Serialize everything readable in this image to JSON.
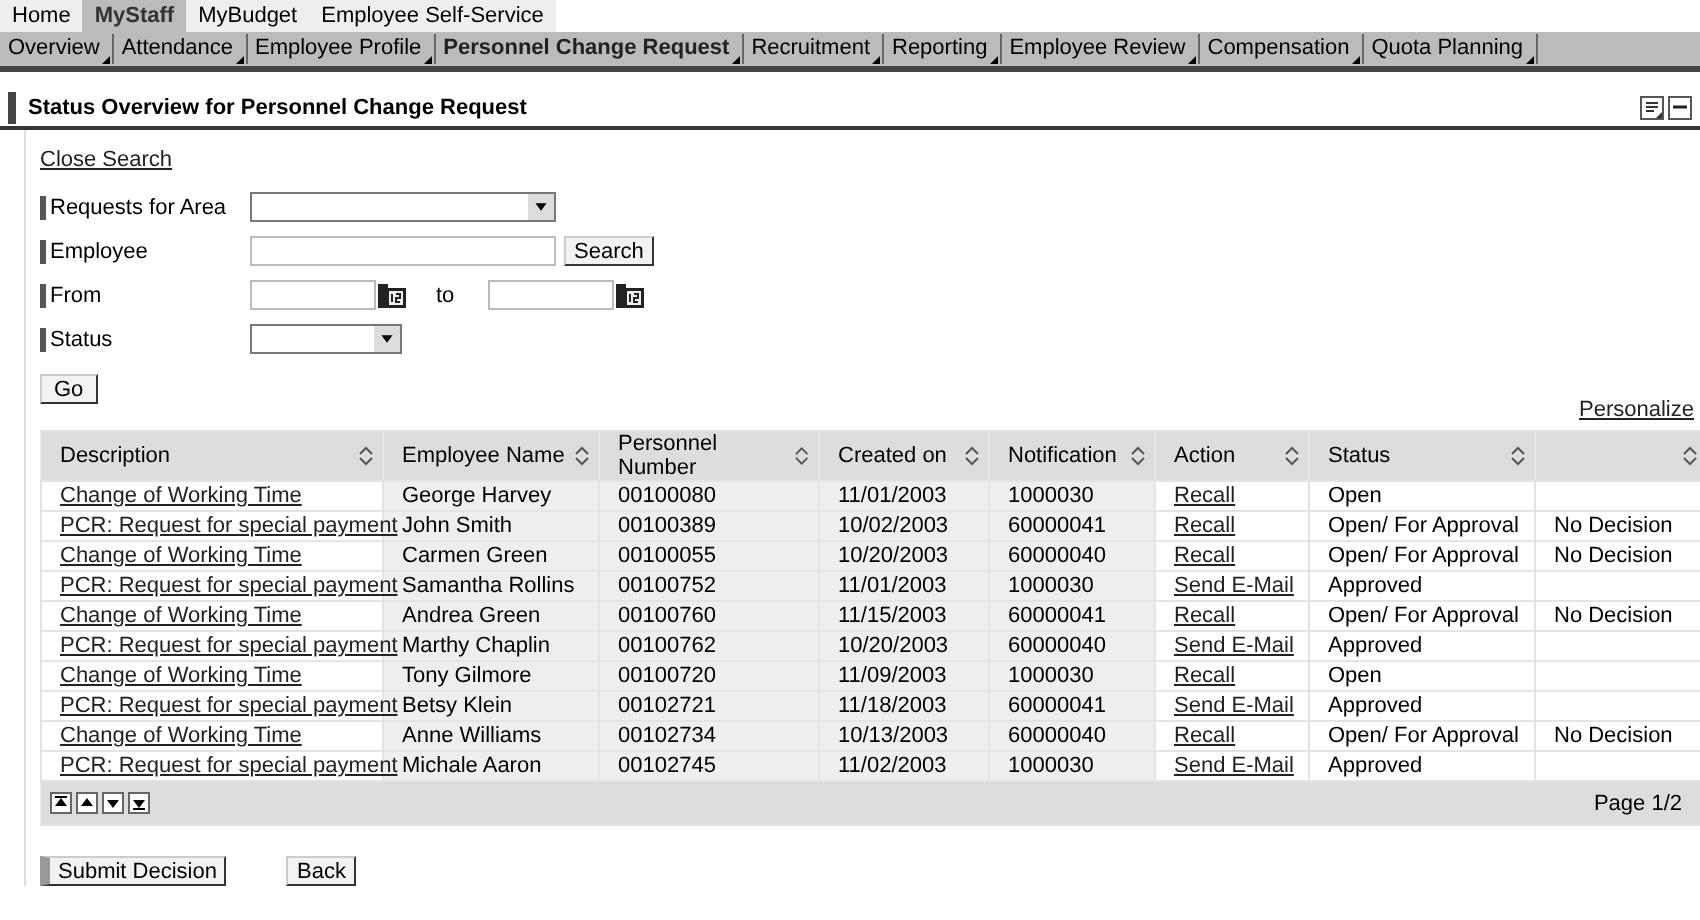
{
  "top_tabs": [
    {
      "label": "Home",
      "selected": false
    },
    {
      "label": "MyStaff",
      "selected": true
    },
    {
      "label": "MyBudget",
      "selected": false
    },
    {
      "label": "Employee Self-Service",
      "selected": false
    }
  ],
  "nav_items": [
    {
      "label": "Overview",
      "selected": false
    },
    {
      "label": "Attendance",
      "selected": false
    },
    {
      "label": "Employee Profile",
      "selected": false
    },
    {
      "label": "Personnel Change Request",
      "selected": true
    },
    {
      "label": "Recruitment",
      "selected": false
    },
    {
      "label": "Reporting",
      "selected": false
    },
    {
      "label": "Employee Review",
      "selected": false
    },
    {
      "label": "Compensation",
      "selected": false
    },
    {
      "label": "Quota Planning",
      "selected": false
    }
  ],
  "panel": {
    "title": "Status Overview for Personnel Change Request"
  },
  "search": {
    "close_link": "Close Search",
    "fields": [
      {
        "kind": "combo",
        "label": "Requests for Area"
      },
      {
        "kind": "text",
        "label": "Employee",
        "button": "Search"
      },
      {
        "kind": "daterange",
        "label": "From",
        "between": "to"
      },
      {
        "kind": "dropdown",
        "label": "Status"
      }
    ],
    "go_button": "Go"
  },
  "personalize_link": "Personalize",
  "table": {
    "columns": [
      "Description",
      "Employee Name",
      "Personnel Number",
      "Created on",
      "Notification",
      "Action",
      "Status",
      ""
    ],
    "rows": [
      [
        "Change of Working Time",
        "George Harvey",
        "00100080",
        "11/01/2003",
        "1000030",
        "Recall",
        "Open",
        ""
      ],
      [
        "PCR: Request for special payment",
        "John Smith",
        "00100389",
        "10/02/2003",
        "60000041",
        "Recall",
        "Open/ For Approval",
        "No Decision"
      ],
      [
        "Change of Working Time",
        "Carmen Green",
        "00100055",
        "10/20/2003",
        "60000040",
        "Recall",
        "Open/ For Approval",
        "No Decision"
      ],
      [
        "PCR: Request for special payment",
        "Samantha Rollins",
        "00100752",
        "11/01/2003",
        "1000030",
        "Send E-Mail",
        "Approved",
        ""
      ],
      [
        "Change of Working Time",
        "Andrea Green",
        "00100760",
        "11/15/2003",
        "60000041",
        "Recall",
        "Open/ For Approval",
        "No Decision"
      ],
      [
        "PCR: Request for special payment",
        "Marthy Chaplin",
        "00100762",
        "10/20/2003",
        "60000040",
        "Send E-Mail",
        "Approved",
        ""
      ],
      [
        "Change of Working Time",
        "Tony Gilmore",
        "00100720",
        "11/09/2003",
        "1000030",
        "Recall",
        "Open",
        ""
      ],
      [
        "PCR: Request for special payment",
        "Betsy Klein",
        "00102721",
        "11/18/2003",
        "60000041",
        "Send E-Mail",
        "Approved",
        ""
      ],
      [
        "Change of Working Time",
        "Anne Williams",
        "00102734",
        "10/13/2003",
        "60000040",
        "Recall",
        "Open/ For Approval",
        "No Decision"
      ],
      [
        "PCR: Request for special payment",
        "Michale Aaron",
        "00102745",
        "11/02/2003",
        "1000030",
        "Send E-Mail",
        "Approved",
        ""
      ]
    ],
    "page": "Page 1/2"
  },
  "buttons": [
    "Submit Decision",
    "Back"
  ]
}
